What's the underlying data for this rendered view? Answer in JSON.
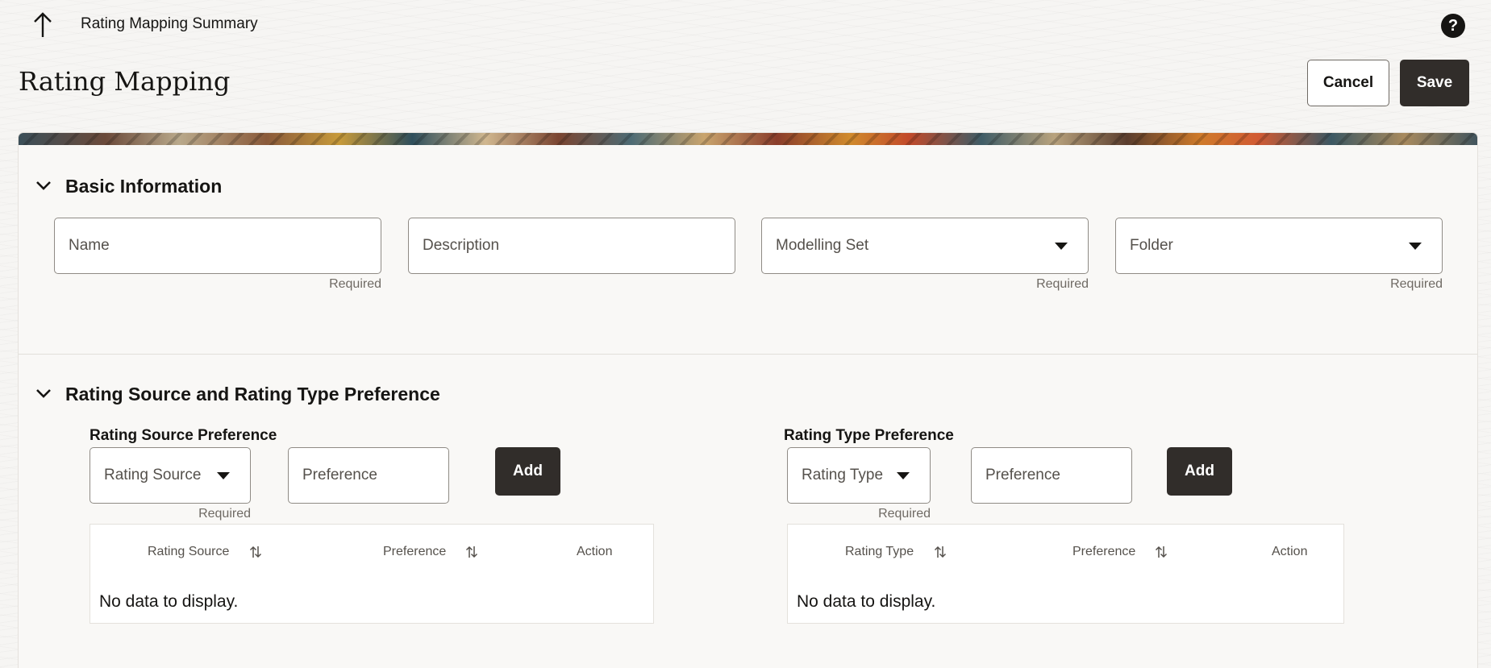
{
  "header": {
    "back_icon": "arrow-up-icon",
    "breadcrumb": "Rating Mapping Summary",
    "help_label": "?",
    "help_icon": "help-icon"
  },
  "page": {
    "title": "Rating Mapping",
    "cancel_label": "Cancel",
    "save_label": "Save"
  },
  "colors": {
    "primary_button": "#312d2a",
    "background": "#f6f5f3",
    "panel": "#f9f8f6"
  },
  "basic_info": {
    "title": "Basic Information",
    "collapse_icon": "chevron-down-icon",
    "name": {
      "label": "Name",
      "helper": "Required"
    },
    "description": {
      "label": "Description"
    },
    "modelling_set": {
      "label": "Modelling Set",
      "helper": "Required"
    },
    "folder": {
      "label": "Folder",
      "helper": "Required"
    }
  },
  "preference": {
    "title": "Rating Source and Rating Type Preference",
    "collapse_icon": "chevron-down-icon",
    "source": {
      "title": "Rating Source Preference",
      "select_label": "Rating Source",
      "select_helper": "Required",
      "preference_label": "Preference",
      "add_label": "Add",
      "columns": [
        "Rating Source",
        "Preference",
        "Action"
      ],
      "sort_icon": "sort-icon",
      "empty_text": "No data to display."
    },
    "type": {
      "title": "Rating Type Preference",
      "select_label": "Rating Type",
      "select_helper": "Required",
      "preference_label": "Preference",
      "add_label": "Add",
      "columns": [
        "Rating Type",
        "Preference",
        "Action"
      ],
      "sort_icon": "sort-icon",
      "empty_text": "No data to display."
    }
  }
}
